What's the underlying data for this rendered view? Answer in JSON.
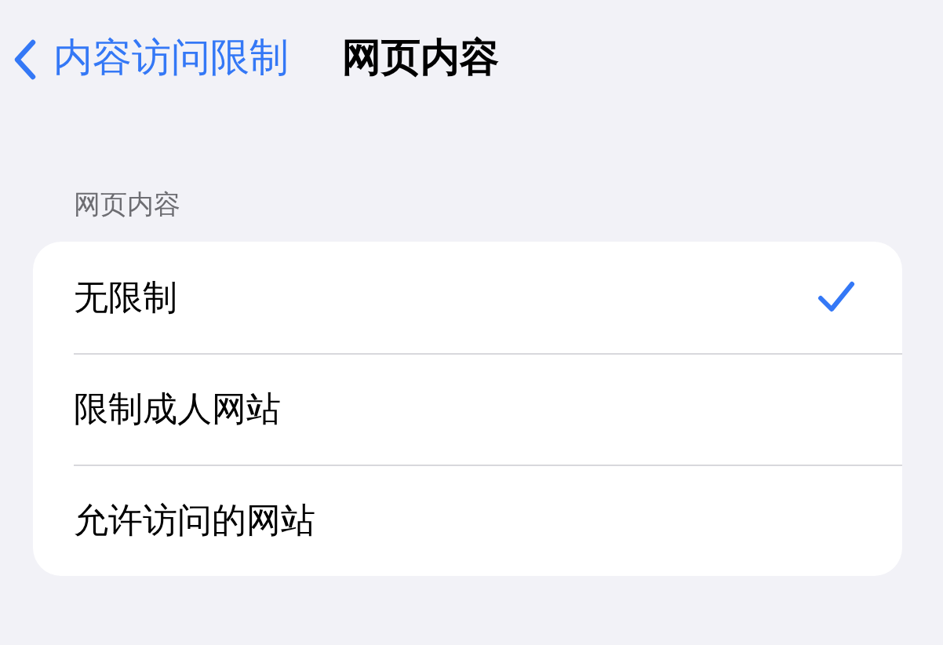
{
  "nav": {
    "back_label": "内容访问限制",
    "title": "网页内容"
  },
  "section": {
    "header": "网页内容",
    "options": [
      {
        "label": "无限制",
        "selected": true
      },
      {
        "label": "限制成人网站",
        "selected": false
      },
      {
        "label": "允许访问的网站",
        "selected": false
      }
    ]
  }
}
